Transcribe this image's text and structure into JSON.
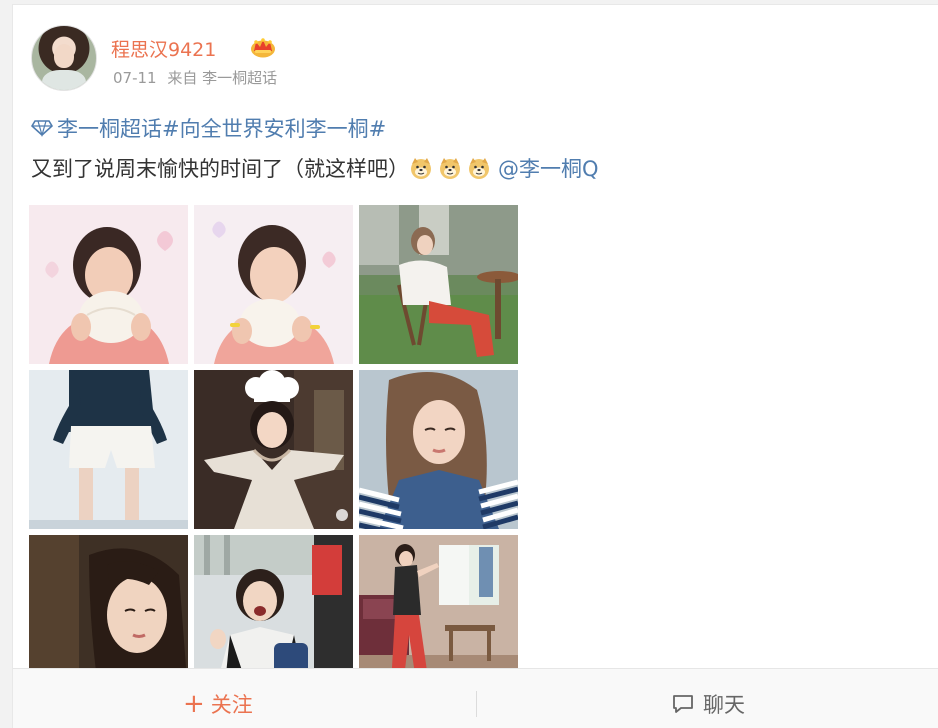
{
  "post": {
    "author": "程思汉9421",
    "author_color": "#eb7350",
    "badge": "crown-icon",
    "time": "07-11",
    "via": "来自",
    "source": "李一桐超话",
    "super_topic": "李一桐超话",
    "hashtag": "#向全世界安利李一桐#",
    "text": "又到了说周末愉快的时间了（就这样吧）",
    "emoji": [
      "doge-emoji",
      "doge-emoji",
      "doge-emoji"
    ],
    "mention": "@李一桐Q",
    "link_color": "#507daf",
    "photos": [
      {
        "name": "photo-bun-1"
      },
      {
        "name": "photo-bun-2"
      },
      {
        "name": "photo-garden-chair"
      },
      {
        "name": "photo-white-shorts"
      },
      {
        "name": "photo-costume-chef-hat"
      },
      {
        "name": "photo-denim-striped"
      },
      {
        "name": "photo-wet-hair"
      },
      {
        "name": "photo-laughing-hospital"
      },
      {
        "name": "photo-living-room"
      }
    ]
  },
  "actions": {
    "follow_label": "关注",
    "follow_icon": "plus-icon",
    "chat_label": "聊天",
    "chat_icon": "chat-bubble-icon"
  }
}
